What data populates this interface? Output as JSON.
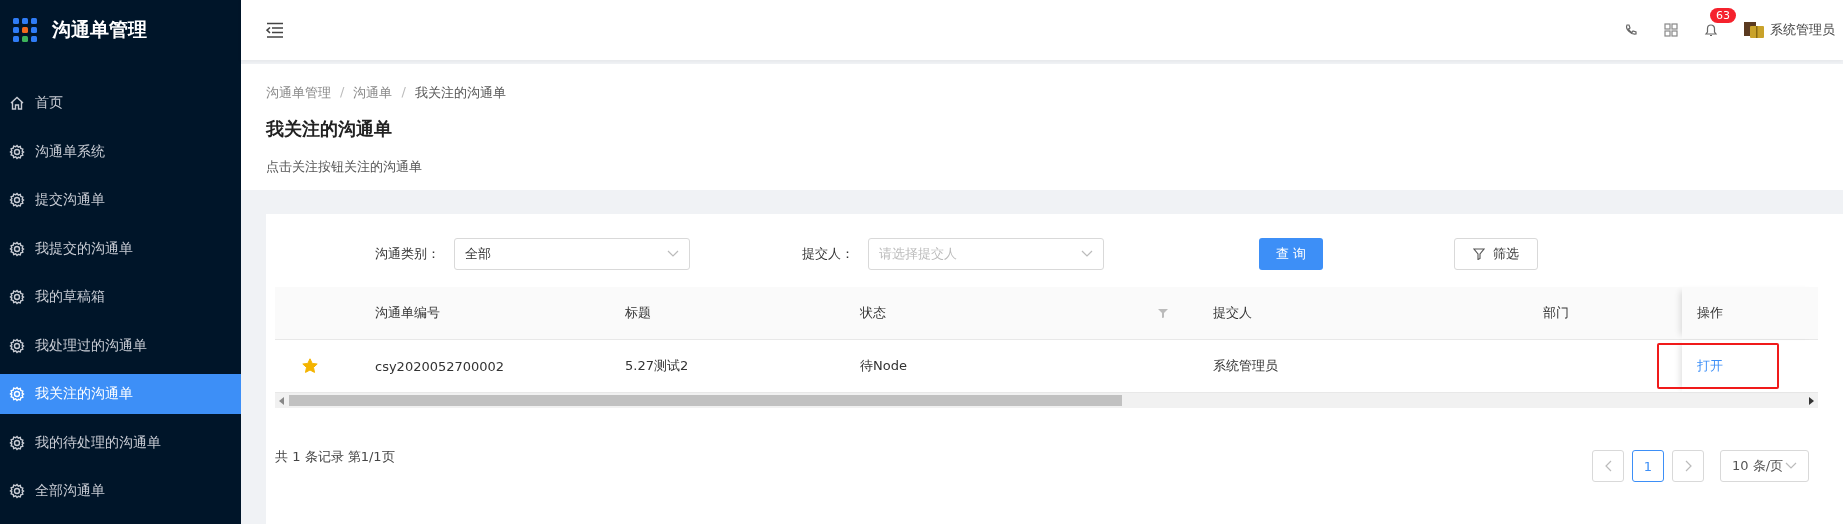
{
  "app": {
    "title": "沟通单管理"
  },
  "sidebar": {
    "items": [
      {
        "label": "首页",
        "kind": "home",
        "selected": false
      },
      {
        "label": "沟通单系统",
        "kind": "gear",
        "selected": false
      },
      {
        "label": "提交沟通单",
        "kind": "gear",
        "selected": false
      },
      {
        "label": "我提交的沟通单",
        "kind": "gear",
        "selected": false
      },
      {
        "label": "我的草稿箱",
        "kind": "gear",
        "selected": false
      },
      {
        "label": "我处理过的沟通单",
        "kind": "gear",
        "selected": false
      },
      {
        "label": "我关注的沟通单",
        "kind": "gear",
        "selected": true
      },
      {
        "label": "我的待处理的沟通单",
        "kind": "gear",
        "selected": false
      },
      {
        "label": "全部沟通单",
        "kind": "gear",
        "selected": false
      }
    ]
  },
  "header": {
    "notification_count": "63",
    "user": "系统管理员"
  },
  "breadcrumb": [
    {
      "kind": "link",
      "text": "沟通单管理"
    },
    {
      "kind": "separator",
      "text": "/"
    },
    {
      "kind": "link",
      "text": "沟通单"
    },
    {
      "kind": "separator",
      "text": "/"
    },
    {
      "kind": "current",
      "text": "我关注的沟通单"
    }
  ],
  "page": {
    "title": "我关注的沟通单",
    "description": "点击关注按钮关注的沟通单"
  },
  "filters": [
    {
      "label": "沟通类别：",
      "value": "全部"
    },
    {
      "label": "提交人：",
      "placeholder": "请选择提交人"
    }
  ],
  "query_button": "查 询",
  "filter_button": "筛选",
  "table": {
    "columns": [
      {
        "label": "沟通单编号",
        "filter": false
      },
      {
        "label": "标题",
        "filter": false
      },
      {
        "label": "状态",
        "filter": true
      },
      {
        "label": "提交人",
        "filter": false
      },
      {
        "label": "部门",
        "filter": false
      },
      {
        "label": "操作",
        "filter": false
      }
    ],
    "rows": [
      {
        "starred": true,
        "cells": [
          "csy2020052700002",
          "5.27测试2",
          "待Node",
          "系统管理员"
        ],
        "action": "打开",
        "highlighted": true
      }
    ]
  },
  "footer": {
    "summary": "共 1 条记录 第1/1页",
    "pages": [
      {
        "label": "1",
        "selected": true
      }
    ],
    "page_size": "10 条/页"
  }
}
